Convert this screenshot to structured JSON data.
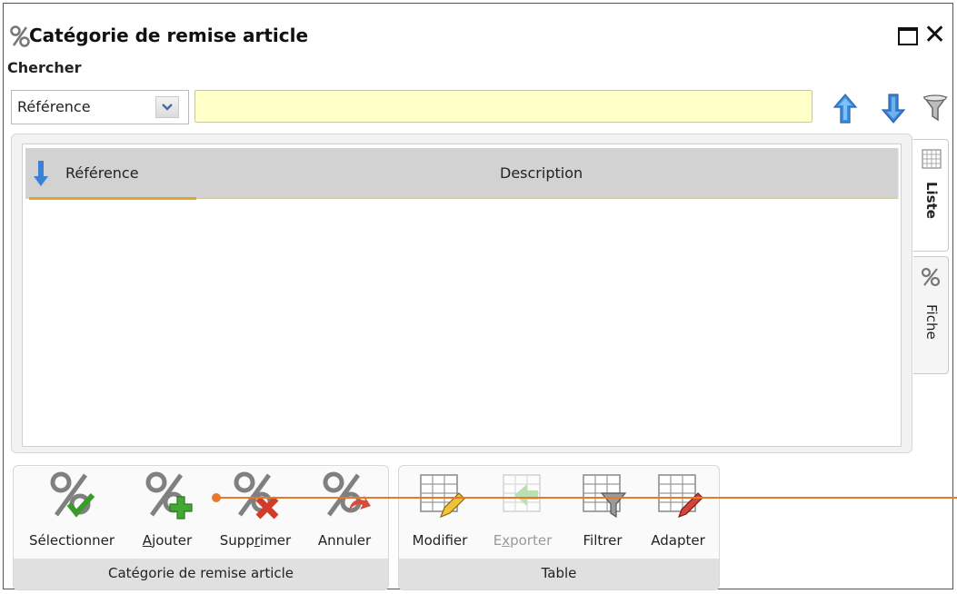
{
  "window": {
    "title": "Catégorie de remise article",
    "title_icon": "percent-icon",
    "maximize_icon": "maximize-icon",
    "close_icon": "close-icon"
  },
  "search": {
    "label": "Chercher",
    "field_select": {
      "selected": "Référence"
    },
    "input_value": "",
    "buttons": [
      "arrow-up-icon",
      "arrow-down-icon",
      "filter-icon"
    ]
  },
  "grid": {
    "sort_icon": "sort-down-icon",
    "columns": [
      "Référence",
      "Description"
    ],
    "rows": []
  },
  "side_tabs": [
    {
      "label": "Liste",
      "icon": "table-grid-icon",
      "active": true
    },
    {
      "label": "Fiche",
      "icon": "percent-icon",
      "active": false
    }
  ],
  "ribbon": {
    "groups": [
      {
        "label": "Catégorie de remise article",
        "buttons": [
          {
            "label": "Sélectionner",
            "icon": "percent-check-icon"
          },
          {
            "label": "Ajouter",
            "icon": "percent-add-icon",
            "accelerator": "A"
          },
          {
            "label": "Supprimer",
            "icon": "percent-delete-icon",
            "accelerator": "r"
          },
          {
            "label": "Annuler",
            "icon": "percent-undo-icon"
          }
        ]
      },
      {
        "label": "Table",
        "buttons": [
          {
            "label": "Modifier",
            "icon": "table-edit-icon"
          },
          {
            "label": "Exporter",
            "icon": "table-export-icon",
            "disabled": true,
            "accelerator": "x"
          },
          {
            "label": "Filtrer",
            "icon": "table-filter-icon"
          },
          {
            "label": "Adapter",
            "icon": "table-adapt-icon"
          }
        ]
      }
    ]
  },
  "colors": {
    "search_input_bg": "#ffffc8",
    "sort_underline": "#e0a52c",
    "arrow_blue": "#3b82d6",
    "annotation": "#e57b2a"
  }
}
